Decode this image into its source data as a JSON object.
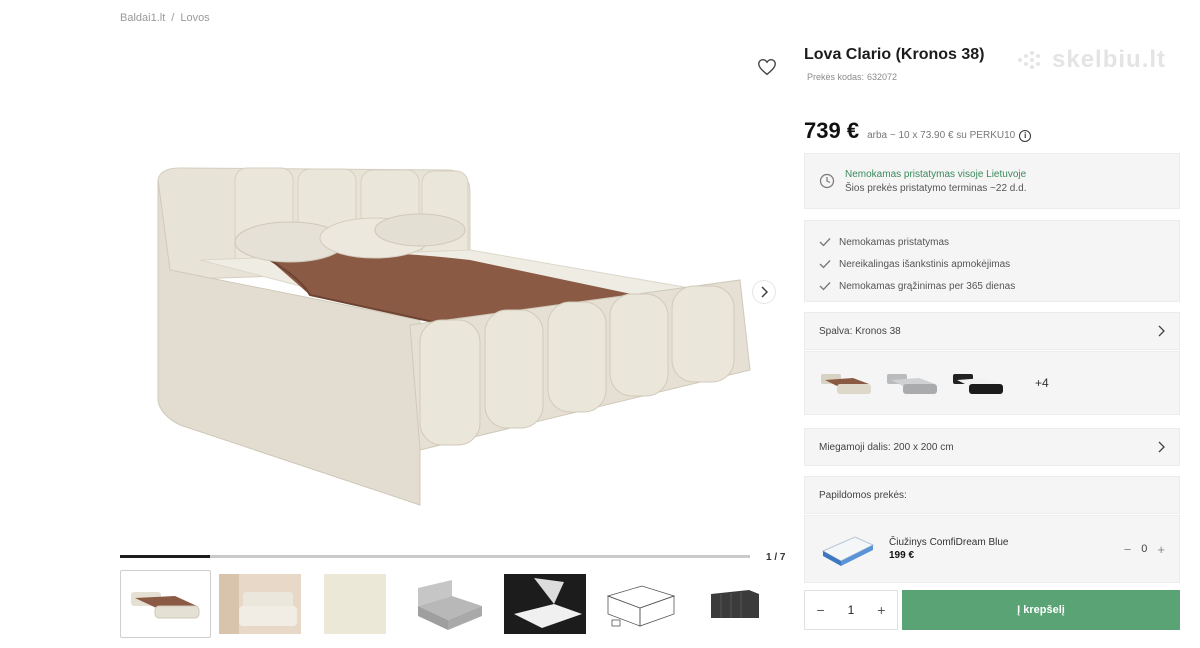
{
  "breadcrumb": {
    "home": "Baldai1.lt",
    "separator": "/",
    "category": "Lovos"
  },
  "product": {
    "title": "Lova Clario (Kronos 38)",
    "code_label": "Prekės kodas:",
    "code_value": "632072",
    "price": "739 €",
    "installment": "arba ~ 10 x 73.90 € su PERKU10",
    "info_icon": "i"
  },
  "watermark": "skelbiu.lt",
  "gallery": {
    "counter": "1 / 7",
    "current": 1,
    "total": 7,
    "progress": 0.143
  },
  "delivery": {
    "title": "Nemokamas pristatymas visoje Lietuvoje",
    "subtitle": "Šios prekės pristatymo terminas ~22 d.d."
  },
  "benefits": [
    "Nemokamas pristatymas",
    "Nereikalingas išankstinis apmokėjimas",
    "Nemokamas grąžinimas per 365 dienas"
  ],
  "color": {
    "label": "Spalva:",
    "value": "Kronos 38",
    "more": "+4"
  },
  "size": {
    "label": "Miegamoji dalis:",
    "value": "200 x 200 cm"
  },
  "extras": {
    "heading": "Papildomos prekės:",
    "item": {
      "name": "Čiužinys ComfiDream Blue",
      "price": "199 €",
      "qty": "0",
      "minus": "−",
      "plus": "+"
    }
  },
  "cart": {
    "qty": "1",
    "minus": "−",
    "plus": "+",
    "button": "Į krepšelį"
  },
  "colors": {
    "accent": "#5aa375",
    "delivery_text": "#3a8a5c",
    "bed": "#e9e4d8",
    "throw": "#8b5a45"
  },
  "icons": [
    "heart-icon",
    "chevron-right-icon",
    "clock-icon",
    "check-icon",
    "info-icon"
  ]
}
